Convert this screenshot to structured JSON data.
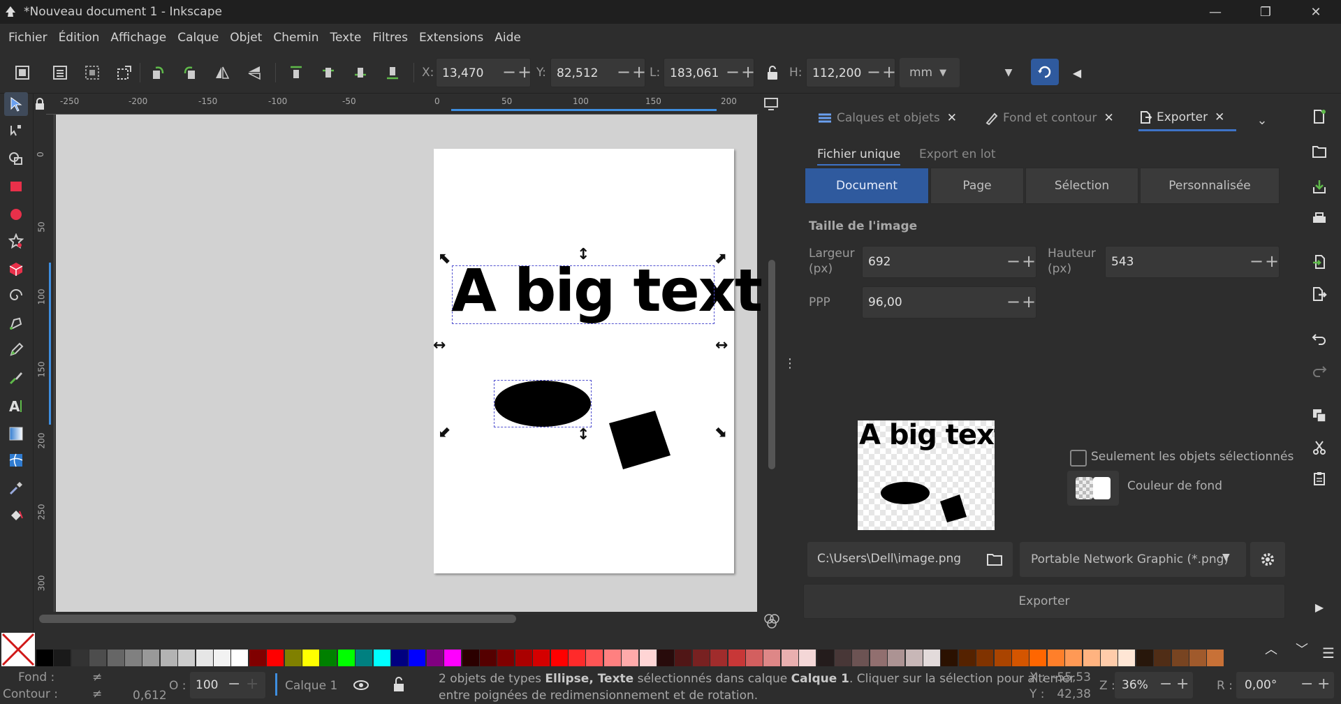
{
  "window": {
    "title": "*Nouveau document 1 - Inkscape"
  },
  "menu": [
    "Fichier",
    "Édition",
    "Affichage",
    "Calque",
    "Objet",
    "Chemin",
    "Texte",
    "Filtres",
    "Extensions",
    "Aide"
  ],
  "toolbar": {
    "x_label": "X:",
    "x_value": "13,470",
    "y_label": "Y:",
    "y_value": "82,512",
    "w_label": "L:",
    "w_value": "183,061",
    "h_label": "H:",
    "h_value": "112,200",
    "unit": "mm"
  },
  "ruler": {
    "h_ticks": [
      "-250",
      "-200",
      "-150",
      "-100",
      "-50",
      "0",
      "50",
      "100",
      "150",
      "200"
    ],
    "v_ticks": [
      "0",
      "50",
      "100",
      "150",
      "200",
      "250",
      "300"
    ]
  },
  "canvas": {
    "text": "A big text"
  },
  "panel": {
    "tabs": [
      "Calques et objets",
      "Fond et contour",
      "Exporter"
    ],
    "subtabs": [
      "Fichier unique",
      "Export en lot"
    ],
    "segments": [
      "Document",
      "Page",
      "Sélection",
      "Personnalisée"
    ],
    "size_title": "Taille de l'image",
    "width_label": "Largeur (px)",
    "width_value": "692",
    "height_label": "Hauteur (px)",
    "height_value": "543",
    "dpi_label": "PPP",
    "dpi_value": "96,00",
    "preview_text": "A big text",
    "only_selected": "Seulement les objets sélectionnés",
    "bg_color": "Couleur de fond",
    "file_path": "C:\\Users\\Dell\\image.png",
    "format": "Portable Network Graphic (*.png)",
    "export_button": "Exporter"
  },
  "status": {
    "fill_label": "Fond :",
    "fill_value": "≠",
    "stroke_label": "Contour :",
    "stroke_value": "≠",
    "stroke_width": "0,612",
    "opacity_label": "O :",
    "opacity_value": "100",
    "layer": "Calque 1",
    "message_1": "2 objets de types ",
    "message_types": "Ellipse, Texte",
    "message_2": " sélectionnés dans calque ",
    "message_layer": "Calque 1",
    "message_3": ". Cliquer sur la sélection pour alterner",
    "message_line2": "entre poignées de redimensionnement et de rotation.",
    "cursor_x_label": "X :",
    "cursor_x": "-55,53",
    "cursor_y_label": "Y :",
    "cursor_y": "42,38",
    "zoom_label": "Z :",
    "zoom": "36%",
    "rotate_label": "R :",
    "rotate": "0,00°"
  },
  "palette": [
    "#000000",
    "#1a1a1a",
    "#333333",
    "#4d4d4d",
    "#666666",
    "#808080",
    "#999999",
    "#b3b3b3",
    "#cccccc",
    "#e6e6e6",
    "#f2f2f2",
    "#ffffff",
    "#800000",
    "#ff0000",
    "#808000",
    "#ffff00",
    "#008000",
    "#00ff00",
    "#008080",
    "#00ffff",
    "#000080",
    "#0000ff",
    "#800080",
    "#ff00ff",
    "#2b0000",
    "#550000",
    "#800000",
    "#aa0000",
    "#d40000",
    "#ff0000",
    "#ff2a2a",
    "#ff5555",
    "#ff8080",
    "#ffaaaa",
    "#ffd5d5",
    "#280b0b",
    "#501616",
    "#782121",
    "#a02c2c",
    "#c83737",
    "#d35f5f",
    "#de8787",
    "#e9afaf",
    "#f4d7d7",
    "#241c1c",
    "#483737",
    "#6c5353",
    "#916f6f",
    "#ac9393",
    "#c8b7b7",
    "#e3dbdb",
    "#2b1100",
    "#552200",
    "#803300",
    "#aa4400",
    "#d45500",
    "#ff6600",
    "#ff7f2a",
    "#ff9955",
    "#ffb380",
    "#ffccaa",
    "#ffe6d5",
    "#28170b",
    "#502d16",
    "#784421",
    "#a05a2c",
    "#c87137"
  ]
}
